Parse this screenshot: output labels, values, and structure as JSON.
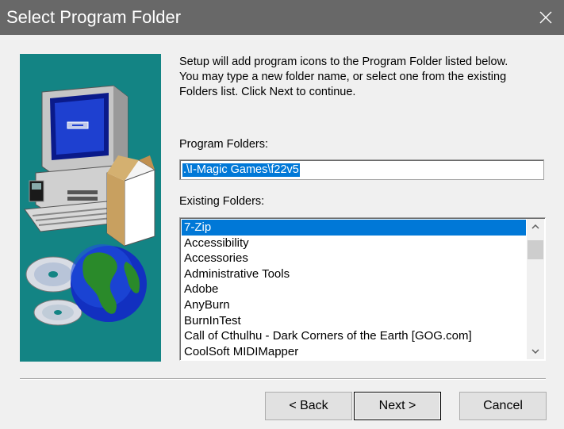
{
  "window": {
    "title": "Select Program Folder"
  },
  "instructions": {
    "line1": "Setup will add program icons to the Program Folder listed below.",
    "line2": "You may type a new folder name, or select one from the existing",
    "line3": "Folders list.  Click Next to continue."
  },
  "program_folders": {
    "label": "Program Folders:",
    "value": ".\\I-Magic Games\\f22v5"
  },
  "existing_folders": {
    "label": "Existing Folders:",
    "selected_index": 0,
    "items": [
      "7-Zip",
      "Accessibility",
      "Accessories",
      "Administrative Tools",
      "Adobe",
      "AnyBurn",
      "BurnInTest",
      "Call of Cthulhu - Dark Corners of the Earth [GOG.com]",
      "CoolSoft MIDIMapper"
    ]
  },
  "buttons": {
    "back": "< Back",
    "next": "Next >",
    "cancel": "Cancel"
  },
  "colors": {
    "titlebar": "#686868",
    "illustration_bg": "#138484",
    "selection": "#0078d7"
  },
  "icons": {
    "close": "close-icon",
    "scroll_up": "chevron-up-icon",
    "scroll_down": "chevron-down-icon"
  }
}
